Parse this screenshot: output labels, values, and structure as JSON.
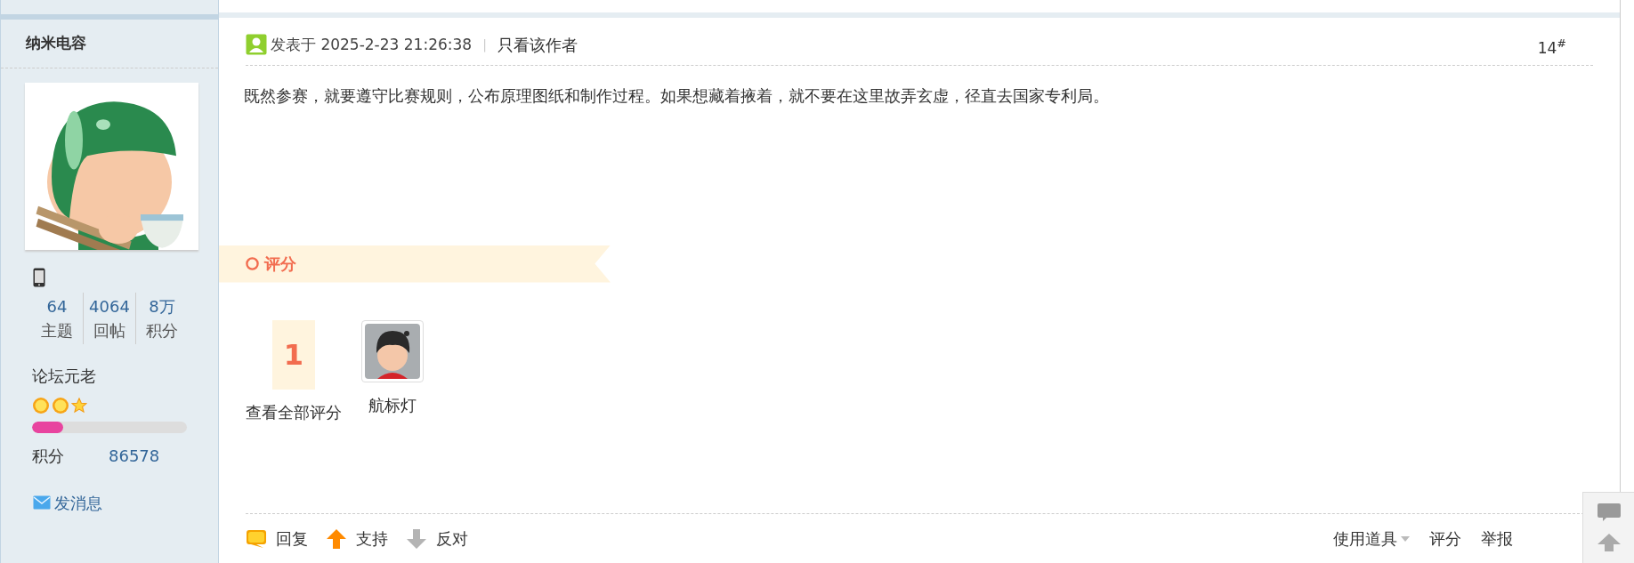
{
  "author": {
    "name": "纳米电容",
    "stats": [
      {
        "value": "64",
        "label": "主题"
      },
      {
        "value": "4064",
        "label": "回帖"
      },
      {
        "value": "8万",
        "label": "积分"
      }
    ],
    "rank": "论坛元老",
    "rank_icons": [
      {
        "kind": "sun"
      },
      {
        "kind": "sun"
      },
      {
        "kind": "star"
      }
    ],
    "progress": {
      "level": 0.2
    },
    "points_label": "积分",
    "points": "86578",
    "message_link": "发消息"
  },
  "post": {
    "posted": "发表于 2025-2-23 21:26:38",
    "separator": "|",
    "only_author": "只看该作者",
    "floor": "14$^{#}$",
    "content": "既然参赛，就要遵守比赛规则，公布原理图纸和制作过程。如果想藏着掖着，就不要在这里故弄玄虚，径直去国家专利局。",
    "rating": {
      "title": "评分",
      "count": "1",
      "view_all": "查看全部评分",
      "raters": [
        {
          "name": "航标灯"
        }
      ]
    },
    "actions": [
      {
        "kind": "reply",
        "label": "回复"
      },
      {
        "kind": "support",
        "label": "支持"
      },
      {
        "kind": "oppose",
        "label": "反对"
      }
    ],
    "tools": [
      {
        "label": "使用道具",
        "dropdown": true
      },
      {
        "label": "评分",
        "dropdown": false
      },
      {
        "label": "举报",
        "dropdown": false
      }
    ]
  }
}
